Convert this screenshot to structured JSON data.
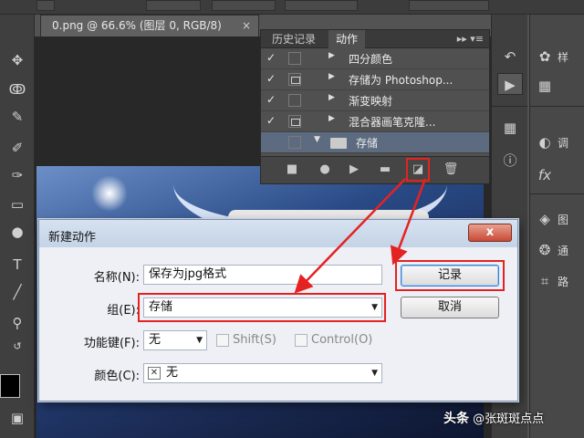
{
  "document": {
    "tab_title": "0.png @ 66.6% (图层 0, RGB/8)",
    "close_glyph": "×"
  },
  "actions_panel": {
    "tabs": [
      "历史记录",
      "动作"
    ],
    "menu_glyph": "▸▸ ▾≡",
    "rows": [
      {
        "checked": true,
        "dialog": false,
        "label": "四分颜色"
      },
      {
        "checked": true,
        "dialog": true,
        "label": "存储为 Photoshop..."
      },
      {
        "checked": true,
        "dialog": false,
        "label": "渐变映射"
      },
      {
        "checked": true,
        "dialog": true,
        "label": "混合器画笔克隆..."
      },
      {
        "checked": false,
        "dialog": false,
        "label": "存储",
        "selected": true
      }
    ],
    "check_glyph": "✓",
    "footer_icons": [
      "stop-icon",
      "record-icon",
      "play-icon",
      "folder-icon",
      "new-action-icon",
      "trash-icon"
    ]
  },
  "dialog": {
    "title": "新建动作",
    "close_label": "x",
    "name_label": "名称(N):",
    "name_value": "保存为jpg格式",
    "set_label": "组(E):",
    "set_value": "存储",
    "fkey_label": "功能键(F):",
    "fkey_value": "无",
    "shift_label": "Shift(S)",
    "control_label": "Control(O)",
    "color_label": "颜色(C):",
    "color_value": "无",
    "record_label": "记录",
    "cancel_label": "取消"
  },
  "right_dock": {
    "labels": [
      "样",
      "调",
      "图",
      "通",
      "路"
    ]
  },
  "watermark": {
    "brand": "头条",
    "handle": "@张斑斑点点"
  },
  "colors": {
    "highlight": "#e52222",
    "selected_row": "#5d6b80"
  }
}
